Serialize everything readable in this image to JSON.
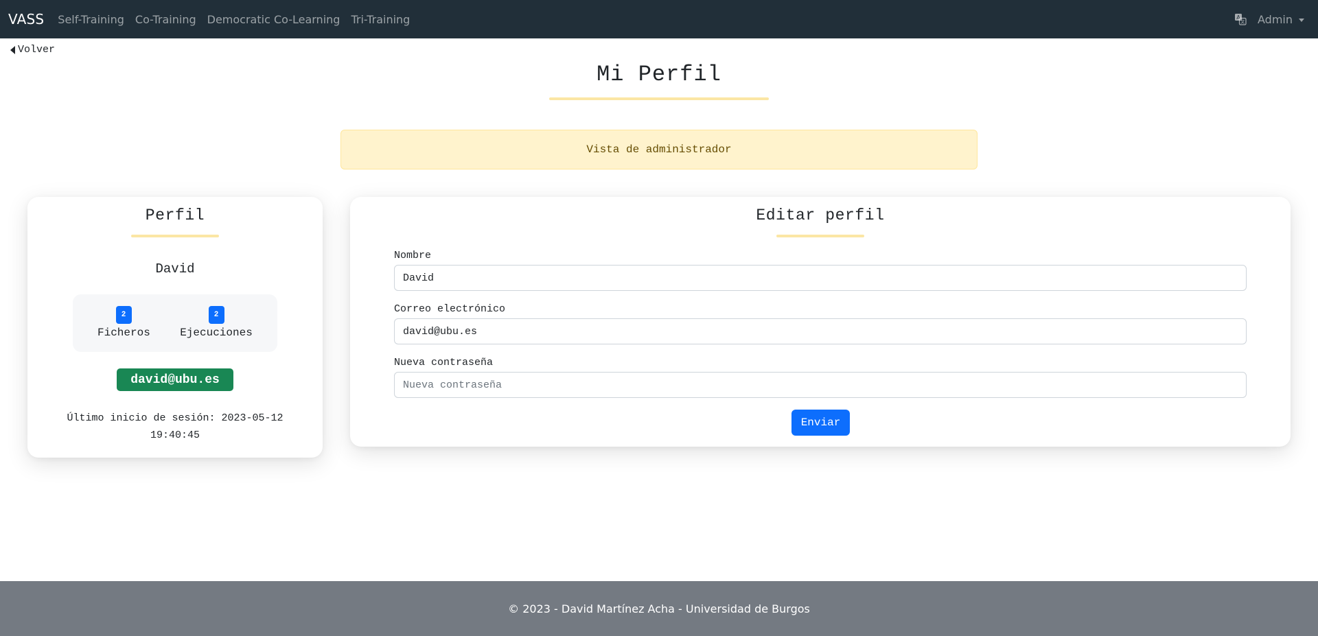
{
  "navbar": {
    "brand": "VASS",
    "links": [
      "Self-Training",
      "Co-Training",
      "Democratic Co-Learning",
      "Tri-Training"
    ],
    "user_menu": "Admin",
    "language_icon": "translate-icon"
  },
  "back": {
    "label": "Volver",
    "icon": "caret-left-icon"
  },
  "page": {
    "title": "Mi Perfil"
  },
  "alert": {
    "text": "Vista de administrador"
  },
  "profile": {
    "heading": "Perfil",
    "name": "David",
    "stats": [
      {
        "count": "2",
        "label": "Ficheros"
      },
      {
        "count": "2",
        "label": "Ejecuciones"
      }
    ],
    "email": "david@ubu.es",
    "last_login_label": "Último inicio de sesión:",
    "last_login_date": "2023-05-12",
    "last_login_time": "19:40:45"
  },
  "edit": {
    "heading": "Editar perfil",
    "name_label": "Nombre",
    "name_value": "David",
    "email_label": "Correo electrónico",
    "email_value": "david@ubu.es",
    "password_label": "Nueva contraseña",
    "password_placeholder": "Nueva contraseña",
    "submit_label": "Enviar"
  },
  "footer": {
    "text": "© 2023 - David Martínez Acha - Universidad de Burgos"
  },
  "colors": {
    "navbar_bg": "#212f39",
    "accent_underline": "#fbe6a4",
    "primary": "#0d6efd",
    "success": "#198754",
    "alert_bg": "#fff3cd",
    "footer_bg": "#747a82"
  }
}
